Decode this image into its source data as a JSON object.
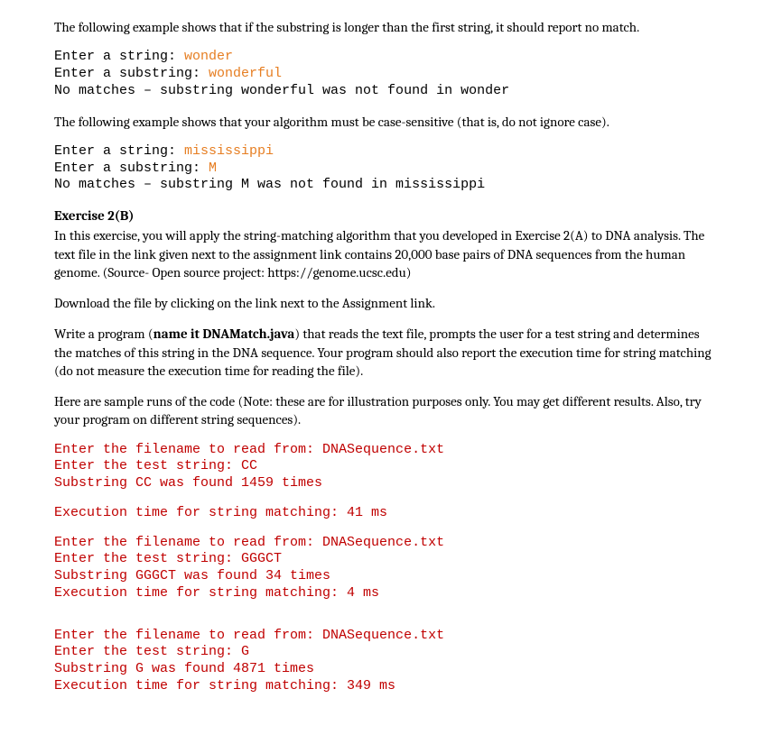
{
  "para1": "The following example shows that if the substring is longer than the first string, it should report no match.",
  "code1": {
    "l1a": "Enter a string: ",
    "l1b": "wonder",
    "l2a": "Enter a substring: ",
    "l2b": "wonderful",
    "l3": "No matches – substring wonderful was not found in wonder"
  },
  "para2": "The following example shows that your algorithm must be case-sensitive (that is, do not ignore case).",
  "code2": {
    "l1a": "Enter a string: ",
    "l1b": "mississippi",
    "l2a": "Enter a substring: ",
    "l2b": "M",
    "l3": "No matches – substring M was not found in mississippi"
  },
  "ex2b_heading": "Exercise 2(B)",
  "ex2b_p1": "In this exercise, you will apply the string-matching algorithm that you developed in Exercise 2(A) to DNA analysis. The text file in the link given next to the assignment link contains 20,000 base pairs of DNA sequences from the human genome. (Source- Open source project: https://genome.ucsc.edu)",
  "ex2b_p2": "Download the file by clicking on the link next to the Assignment link.",
  "ex2b_p3a": "Write a program (",
  "ex2b_p3b": "name it DNAMatch.java",
  "ex2b_p3c": ") that reads the text file, prompts the user for a test string and determines the matches of this string in the DNA sequence. Your program should also report the execution time for string matching (do not measure the execution time for reading the file).",
  "ex2b_p4": "Here are sample runs of the code (Note: these are for illustration purposes only. You may get different results. Also, try your program on different string sequences).",
  "run1": "Enter the filename to read from: DNASequence.txt\nEnter the test string: CC\nSubstring CC was found 1459 times",
  "run1b": "Execution time for string matching: 41 ms",
  "run2": "Enter the filename to read from: DNASequence.txt\nEnter the test string: GGGCT\nSubstring GGGCT was found 34 times\nExecution time for string matching: 4 ms",
  "run3": "Enter the filename to read from: DNASequence.txt\nEnter the test string: G\nSubstring G was found 4871 times\nExecution time for string matching: 349 ms"
}
